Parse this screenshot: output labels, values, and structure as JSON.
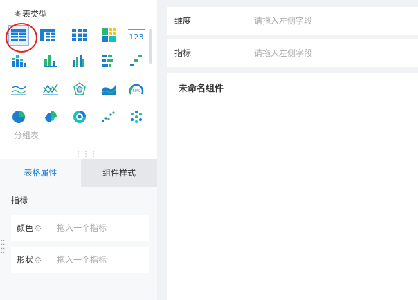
{
  "chart_types": {
    "title": "图表类型",
    "hover_label": "分组表",
    "selected": "table-icon",
    "rows": [
      [
        "table-icon",
        "cross-table-icon",
        "grid-table-icon",
        "heatmap-table-icon",
        "kpi-number-icon"
      ],
      [
        "stacked-bar-icon",
        "column-bar-icon",
        "grouped-bar-icon",
        "horizontal-bar-icon",
        "waterfall-icon"
      ],
      [
        "line-chart-icon",
        "multi-line-icon",
        "radar-icon",
        "area-chart-icon",
        "gauge-icon"
      ],
      [
        "pie-chart-icon",
        "rose-pie-icon",
        "donut-chart-icon",
        "scatter-icon",
        "bubble-icon"
      ]
    ],
    "kpi_text": "123",
    "gauge_text": "60%"
  },
  "property_tabs": {
    "active": "表格属性",
    "inactive": "组件样式"
  },
  "metrics": {
    "header": "指标",
    "fields": [
      {
        "label": "颜色",
        "placeholder": "拖入一个指标"
      },
      {
        "label": "形状",
        "placeholder": "拖入一个指标"
      }
    ]
  },
  "drop_zones": [
    {
      "label": "维度",
      "placeholder": "请拖入左侧字段"
    },
    {
      "label": "指标",
      "placeholder": "请拖入左侧字段"
    }
  ],
  "canvas": {
    "title": "未命名组件"
  },
  "colors": {
    "blue": "#1a7fd3",
    "green": "#2bb673",
    "cyan": "#13c2c2",
    "yellow": "#f5c42c",
    "red_highlight": "#e02424"
  }
}
